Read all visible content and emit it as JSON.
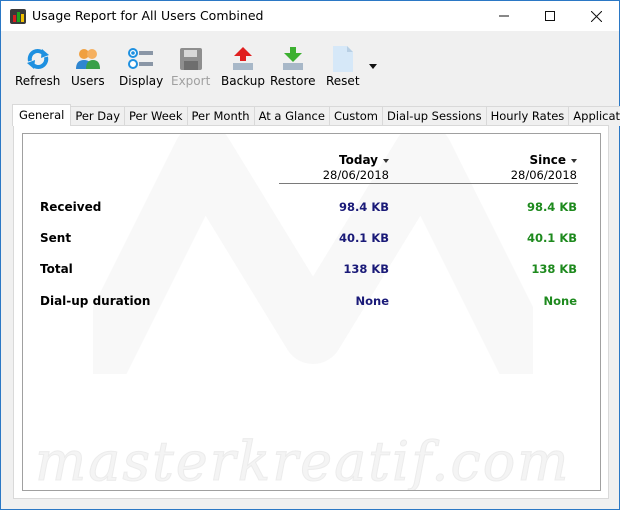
{
  "window": {
    "title": "Usage Report for All Users Combined",
    "icon": "bar-chart-icon",
    "controls": [
      "minimize-icon",
      "maximize-icon",
      "close-icon"
    ]
  },
  "toolbar": {
    "buttons": [
      {
        "label": "Refresh",
        "icon": "refresh-icon",
        "enabled": true
      },
      {
        "label": "Users",
        "icon": "users-icon",
        "enabled": true
      },
      {
        "label": "Display",
        "icon": "display-list-icon",
        "enabled": true
      },
      {
        "label": "Export",
        "icon": "floppy-disk-icon",
        "enabled": false
      },
      {
        "label": "Backup",
        "icon": "upload-arrow-icon",
        "enabled": true
      },
      {
        "label": "Restore",
        "icon": "download-arrow-icon",
        "enabled": true
      },
      {
        "label": "Reset",
        "icon": "blank-document-icon",
        "enabled": true
      }
    ],
    "more_icon": "dropdown-arrow-icon"
  },
  "tabs": [
    {
      "label": "General",
      "active": true
    },
    {
      "label": "Per Day",
      "active": false
    },
    {
      "label": "Per Week",
      "active": false
    },
    {
      "label": "Per Month",
      "active": false
    },
    {
      "label": "At a Glance",
      "active": false
    },
    {
      "label": "Custom",
      "active": false
    },
    {
      "label": "Dial-up Sessions",
      "active": false
    },
    {
      "label": "Hourly Rates",
      "active": false
    },
    {
      "label": "Applications",
      "active": false
    }
  ],
  "report": {
    "columns": [
      {
        "header": "Today",
        "date": "28/06/2018",
        "color": "#1a1a78"
      },
      {
        "header": "Since",
        "date": "28/06/2018",
        "color": "#1e8a1e"
      }
    ],
    "rows": [
      {
        "label": "Received",
        "today": "98.4 KB",
        "since": "98.4 KB"
      },
      {
        "label": "Sent",
        "today": "40.1 KB",
        "since": "40.1 KB"
      },
      {
        "label": "Total",
        "today": "138 KB",
        "since": "138 KB"
      },
      {
        "label": "Dial-up duration",
        "today": "None",
        "since": "None"
      }
    ]
  },
  "watermark": "masterkreatif.com"
}
